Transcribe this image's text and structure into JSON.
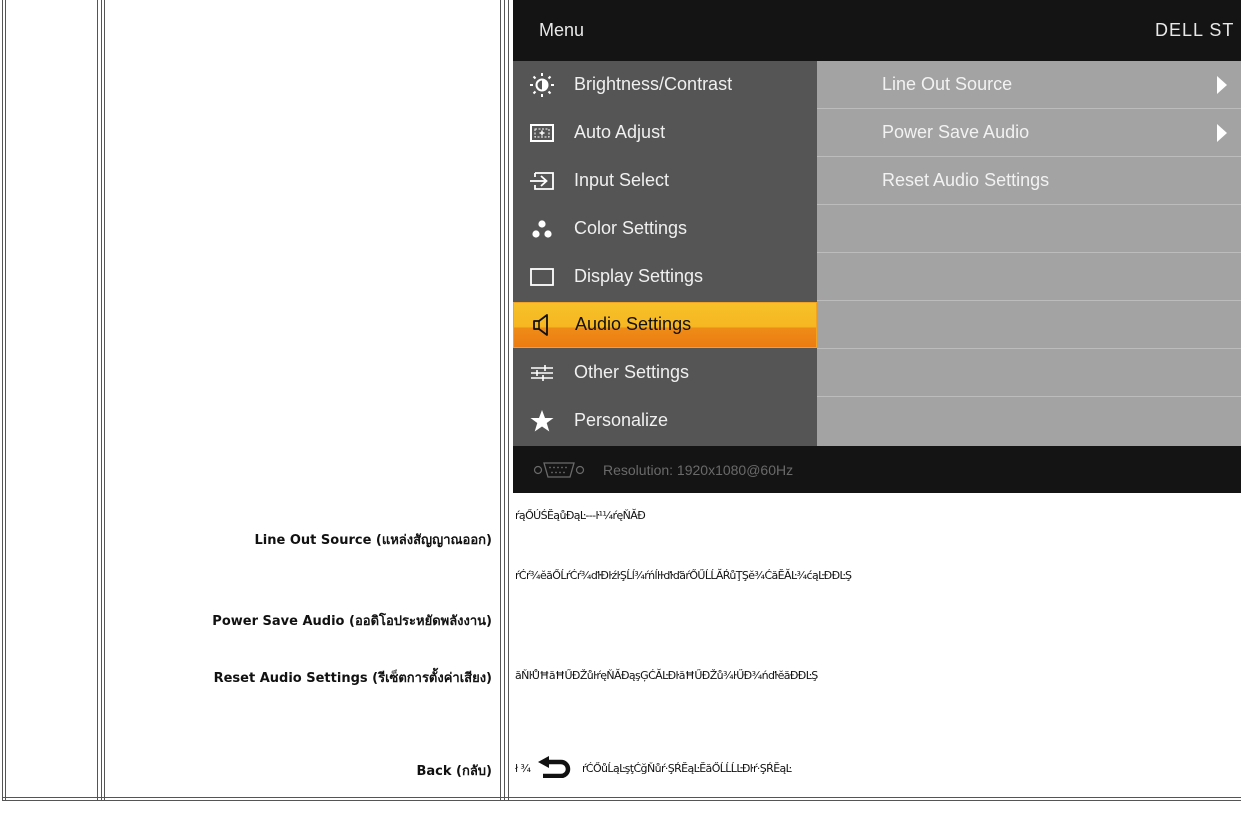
{
  "osd": {
    "header": {
      "title": "Menu",
      "model": "DELL ST"
    },
    "menu_items": [
      {
        "label": "Brightness/Contrast",
        "icon": "brightness-icon",
        "selected": false
      },
      {
        "label": "Auto Adjust",
        "icon": "auto-adjust-icon",
        "selected": false
      },
      {
        "label": "Input Select",
        "icon": "input-select-icon",
        "selected": false
      },
      {
        "label": "Color Settings",
        "icon": "color-settings-icon",
        "selected": false
      },
      {
        "label": "Display Settings",
        "icon": "display-settings-icon",
        "selected": false
      },
      {
        "label": "Audio Settings",
        "icon": "speaker-icon",
        "selected": true
      },
      {
        "label": "Other Settings",
        "icon": "other-settings-icon",
        "selected": false
      },
      {
        "label": "Personalize",
        "icon": "star-icon",
        "selected": false
      }
    ],
    "submenu": [
      {
        "label": "Line Out Source",
        "has_arrow": true
      },
      {
        "label": "Power Save Audio",
        "has_arrow": true
      },
      {
        "label": "Reset Audio Settings",
        "has_arrow": false
      },
      {
        "label": "",
        "has_arrow": false
      },
      {
        "label": "",
        "has_arrow": false
      },
      {
        "label": "",
        "has_arrow": false
      },
      {
        "label": "",
        "has_arrow": false
      },
      {
        "label": "",
        "has_arrow": false
      }
    ],
    "footer": {
      "resolution": "Resolution:  1920x1080@60Hz",
      "connector_icon": "vga-connector-icon"
    },
    "colors": {
      "header": "#141414",
      "left_panel": "#555555",
      "right_panel": "#a3a3a3",
      "highlight": "#f6b622"
    }
  },
  "rows": [
    {
      "label": "Line Out Source  (แหล่งสัญญาณออก)",
      "description": "ŕąŐÚŚĔąůĐąĿ---ŀ¹¼ŕęŇĂĐ"
    },
    {
      "label": "Power Save  Audio (ออดิโอประหยัดพลังงาน)",
      "description": "ŕĆŕ¾ĕăŐĹŕĆŕ¾ďŀĐŀźŀŞĹĺ¾ŕńĺŀŀďŀďăŕŐŰĹĹĂŔůŢŞĕ¾ĆăĔĂĿ¾ćąĿĐĐĿŞ"
    },
    {
      "label": "Reset Audio Settings (รีเซ็ตการตั้งค่าเสียง)",
      "description": "ăŇŀŮĦăĦŰĐŽůŀŕęŇĂĐąşĢĆĂĿĐŀăĦŰĐŽů¾ŀŰĐ¾ńďŀĕăĐĐĿŞ"
    },
    {
      "label": "Back (กลับ)",
      "description": "ŕĆŐůĹąĿşţĆğŇůŕ·ŞŔĔąĿĔăŐĹĹĹĿĐŀŕ·ŞŔĔąĿ",
      "prefix": "ł ¾",
      "icon": "back-arrow-icon"
    }
  ]
}
